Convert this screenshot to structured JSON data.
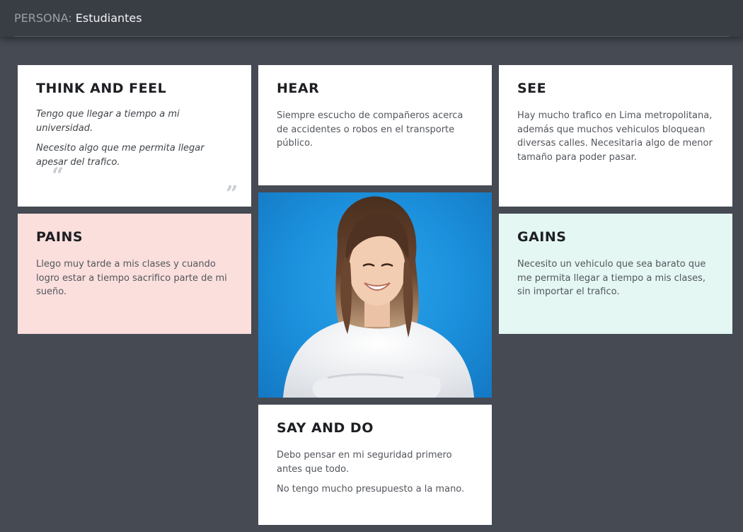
{
  "header": {
    "label": "PERSONA:",
    "persona_name": "Estudiantes"
  },
  "think_feel": {
    "title": "THINK AND FEEL",
    "open_quote": "“",
    "close_quote": "”",
    "lines": [
      "Tengo que llegar a tiempo a mi universidad.",
      "Necesito algo que me permita llegar apesar del trafico."
    ]
  },
  "hear": {
    "title": "HEAR",
    "lines": [
      "Siempre escucho de compañeros acerca de accidentes o robos en el transporte público."
    ]
  },
  "see": {
    "title": "SEE",
    "lines": [
      "Hay mucho trafico en Lima metropolitana, además que muchos vehiculos bloquean diversas calles. Necesitaria algo de menor tamaño para poder pasar."
    ]
  },
  "pains": {
    "title": "PAINS",
    "lines": [
      "Llego muy tarde a mis clases y cuando logro estar a tiempo sacrifico parte de mi sueño."
    ]
  },
  "gains": {
    "title": "GAINS",
    "lines": [
      "Necesito un vehiculo que sea barato que me permita llegar a tiempo a mis clases, sin importar el trafico."
    ]
  },
  "say_do": {
    "title": "SAY AND DO",
    "lines": [
      "Debo pensar en mi seguridad primero antes que todo.",
      "No tengo mucho presupuesto a la mano."
    ]
  },
  "photo": {
    "icon": "persona-photo",
    "colors": {
      "background": "#1b8fdb",
      "hair": "#5a3a26",
      "hair_tips": "#c9a884",
      "skin": "#f2cdb2",
      "shirt": "#f3f4f6"
    }
  },
  "colors": {
    "page_bg": "#454a53",
    "header_bg": "#393e45",
    "card_bg": "#ffffff",
    "pains_bg": "#fbdfdd",
    "gains_bg": "#e4f7f3"
  }
}
